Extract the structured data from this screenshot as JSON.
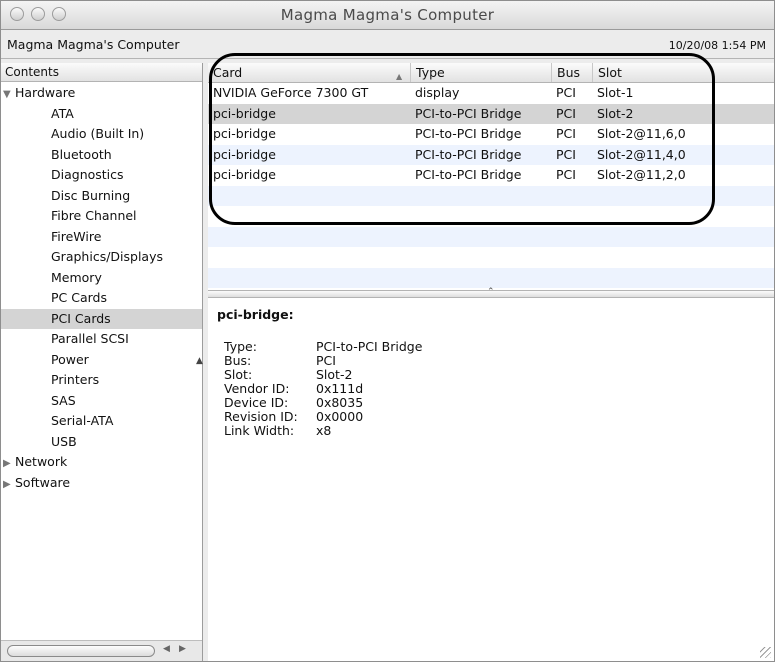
{
  "window": {
    "title": "Magma Magma's Computer"
  },
  "header": {
    "computer_name": "Magma Magma's Computer",
    "timestamp": "10/20/08 1:54 PM"
  },
  "sidebar": {
    "header": "Contents",
    "items": [
      {
        "label": "Hardware",
        "level": 0,
        "expanded": true
      },
      {
        "label": "ATA",
        "level": 1
      },
      {
        "label": "Audio (Built In)",
        "level": 1
      },
      {
        "label": "Bluetooth",
        "level": 1
      },
      {
        "label": "Diagnostics",
        "level": 1
      },
      {
        "label": "Disc Burning",
        "level": 1
      },
      {
        "label": "Fibre Channel",
        "level": 1
      },
      {
        "label": "FireWire",
        "level": 1
      },
      {
        "label": "Graphics/Displays",
        "level": 1
      },
      {
        "label": "Memory",
        "level": 1
      },
      {
        "label": "PC Cards",
        "level": 1
      },
      {
        "label": "PCI Cards",
        "level": 1,
        "selected": true
      },
      {
        "label": "Parallel SCSI",
        "level": 1
      },
      {
        "label": "Power",
        "level": 1
      },
      {
        "label": "Printers",
        "level": 1
      },
      {
        "label": "SAS",
        "level": 1
      },
      {
        "label": "Serial-ATA",
        "level": 1
      },
      {
        "label": "USB",
        "level": 1
      },
      {
        "label": "Network",
        "level": 0,
        "expanded": false
      },
      {
        "label": "Software",
        "level": 0,
        "expanded": false
      }
    ]
  },
  "table": {
    "columns": {
      "card": "Card",
      "type": "Type",
      "bus": "Bus",
      "slot": "Slot"
    },
    "rows": [
      {
        "card": "NVIDIA GeForce 7300 GT",
        "type": "display",
        "bus": "PCI",
        "slot": "Slot-1"
      },
      {
        "card": "pci-bridge",
        "type": "PCI-to-PCI Bridge",
        "bus": "PCI",
        "slot": "Slot-2",
        "selected": true
      },
      {
        "card": "pci-bridge",
        "type": "PCI-to-PCI Bridge",
        "bus": "PCI",
        "slot": "Slot-2@11,6,0"
      },
      {
        "card": "pci-bridge",
        "type": "PCI-to-PCI Bridge",
        "bus": "PCI",
        "slot": "Slot-2@11,4,0"
      },
      {
        "card": "pci-bridge",
        "type": "PCI-to-PCI Bridge",
        "bus": "PCI",
        "slot": "Slot-2@11,2,0"
      }
    ]
  },
  "detail": {
    "title": "pci-bridge:",
    "fields": [
      {
        "key": "Type:",
        "value": "PCI-to-PCI Bridge"
      },
      {
        "key": "Bus:",
        "value": "PCI"
      },
      {
        "key": "Slot:",
        "value": "Slot-2"
      },
      {
        "key": "Vendor ID:",
        "value": "0x111d"
      },
      {
        "key": "Device ID:",
        "value": "0x8035"
      },
      {
        "key": "Revision ID:",
        "value": "0x0000"
      },
      {
        "key": "Link Width:",
        "value": "x8"
      }
    ]
  },
  "colors": {
    "selection": "#d4d4d4",
    "alternate_row": "#edf3fe",
    "annotation_outline": "#000000"
  }
}
